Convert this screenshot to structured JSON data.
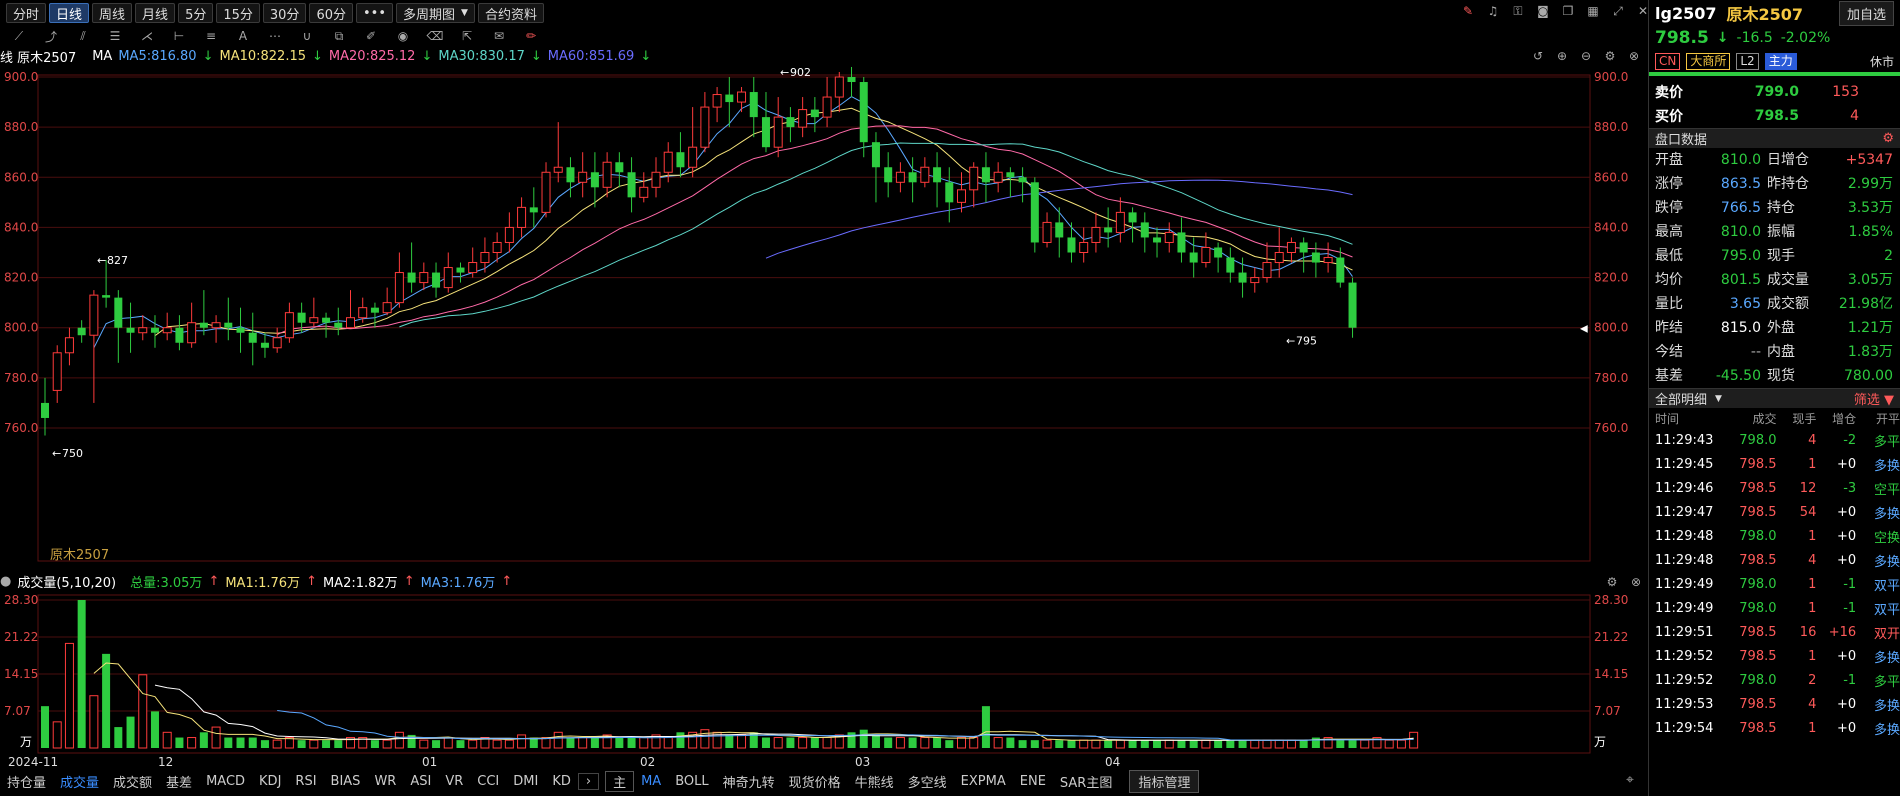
{
  "toolbar": {
    "periods": [
      "分时",
      "日线",
      "周线",
      "月线",
      "5分",
      "15分",
      "30分",
      "60分"
    ],
    "active_period": "日线",
    "more": "•••",
    "multi_period": "多周期图",
    "contract_info": "合约资料"
  },
  "ma_legend": {
    "prefix": "线 原木2507",
    "ma_label": "MA",
    "ma5": "MA5:816.80",
    "ma10": "MA10:822.15",
    "ma20": "MA20:825.12",
    "ma30": "MA30:830.17",
    "ma60": "MA60:851.69"
  },
  "vol_legend": {
    "title": "成交量(5,10,20)",
    "total": "总量:3.05万",
    "ma1": "MA1:1.76万",
    "ma2": "MA2:1.82万",
    "ma3": "MA3:1.76万"
  },
  "chart_data": [
    {
      "type": "candlestick",
      "title": "原木2507",
      "y_ticks": [
        "900.0",
        "880.0",
        "860.0",
        "840.0",
        "820.0",
        "800.0",
        "780.0",
        "760.0"
      ],
      "ylim": [
        750,
        905
      ],
      "x_ticks": [
        "2024-11",
        "12",
        "01",
        "02",
        "03",
        "04"
      ],
      "annotations": {
        "high": "902",
        "low": "795",
        "mid_high": "827",
        "start_low": "750"
      },
      "watermark": "原木2507",
      "candles": [
        [
          770,
          764,
          780,
          757
        ],
        [
          775,
          790,
          793,
          770
        ],
        [
          790,
          796,
          800,
          785
        ],
        [
          800,
          797,
          803,
          794
        ],
        [
          797,
          813,
          815,
          770
        ],
        [
          813,
          812,
          827,
          808
        ],
        [
          812,
          800,
          815,
          786
        ],
        [
          800,
          798,
          810,
          790
        ],
        [
          798,
          800,
          805,
          795
        ],
        [
          800,
          798,
          805,
          792
        ],
        [
          798,
          800,
          806,
          795
        ],
        [
          800,
          794,
          805,
          791
        ],
        [
          794,
          802,
          810,
          792
        ],
        [
          802,
          800,
          815,
          797
        ],
        [
          800,
          802,
          805,
          794
        ],
        [
          802,
          800,
          812,
          795
        ],
        [
          800,
          798,
          808,
          790
        ],
        [
          798,
          794,
          806,
          785
        ],
        [
          794,
          792,
          798,
          788
        ],
        [
          792,
          796,
          800,
          790
        ],
        [
          796,
          806,
          810,
          794
        ],
        [
          806,
          802,
          810,
          798
        ],
        [
          802,
          804,
          812,
          800
        ],
        [
          804,
          802,
          806,
          796
        ],
        [
          802,
          800,
          808,
          797
        ],
        [
          800,
          804,
          815,
          800
        ],
        [
          804,
          808,
          812,
          802
        ],
        [
          808,
          806,
          810,
          800
        ],
        [
          806,
          810,
          816,
          805
        ],
        [
          810,
          822,
          830,
          808
        ],
        [
          822,
          818,
          834,
          814
        ],
        [
          818,
          822,
          826,
          815
        ],
        [
          822,
          816,
          826,
          812
        ],
        [
          816,
          824,
          830,
          814
        ],
        [
          824,
          822,
          826,
          818
        ],
        [
          822,
          826,
          832,
          820
        ],
        [
          826,
          830,
          836,
          822
        ],
        [
          830,
          834,
          838,
          826
        ],
        [
          834,
          840,
          846,
          830
        ],
        [
          840,
          848,
          852,
          836
        ],
        [
          848,
          846,
          856,
          840
        ],
        [
          846,
          862,
          866,
          844
        ],
        [
          862,
          864,
          882,
          858
        ],
        [
          864,
          858,
          868,
          852
        ],
        [
          858,
          862,
          870,
          852
        ],
        [
          862,
          856,
          870,
          848
        ],
        [
          856,
          866,
          870,
          852
        ],
        [
          866,
          862,
          870,
          856
        ],
        [
          862,
          852,
          868,
          846
        ],
        [
          852,
          856,
          862,
          850
        ],
        [
          856,
          862,
          868,
          852
        ],
        [
          862,
          870,
          874,
          858
        ],
        [
          870,
          864,
          878,
          860
        ],
        [
          864,
          872,
          888,
          860
        ],
        [
          872,
          888,
          894,
          870
        ],
        [
          888,
          893,
          896,
          882
        ],
        [
          893,
          890,
          900,
          880
        ],
        [
          890,
          894,
          896,
          886
        ],
        [
          894,
          884,
          900,
          876
        ],
        [
          884,
          872,
          894,
          870
        ],
        [
          872,
          884,
          892,
          868
        ],
        [
          884,
          880,
          888,
          874
        ],
        [
          880,
          887,
          892,
          876
        ],
        [
          887,
          884,
          892,
          878
        ],
        [
          884,
          892,
          900,
          880
        ],
        [
          892,
          900,
          902,
          886
        ],
        [
          900,
          898,
          904,
          892
        ],
        [
          898,
          874,
          900,
          868
        ],
        [
          874,
          864,
          878,
          850
        ],
        [
          864,
          858,
          870,
          852
        ],
        [
          858,
          862,
          866,
          854
        ],
        [
          862,
          858,
          868,
          850
        ],
        [
          858,
          864,
          868,
          856
        ],
        [
          864,
          858,
          870,
          848
        ],
        [
          858,
          850,
          864,
          842
        ],
        [
          850,
          855,
          862,
          846
        ],
        [
          855,
          864,
          866,
          848
        ],
        [
          864,
          858,
          870,
          850
        ],
        [
          858,
          862,
          866,
          854
        ],
        [
          862,
          860,
          864,
          852
        ],
        [
          860,
          858,
          864,
          850
        ],
        [
          858,
          834,
          860,
          830
        ],
        [
          834,
          842,
          846,
          832
        ],
        [
          842,
          836,
          848,
          828
        ],
        [
          836,
          830,
          842,
          826
        ],
        [
          830,
          834,
          840,
          826
        ],
        [
          834,
          840,
          846,
          830
        ],
        [
          840,
          838,
          848,
          832
        ],
        [
          838,
          846,
          852,
          834
        ],
        [
          846,
          842,
          848,
          834
        ],
        [
          842,
          836,
          846,
          830
        ],
        [
          836,
          834,
          840,
          828
        ],
        [
          834,
          838,
          842,
          830
        ],
        [
          838,
          830,
          844,
          826
        ],
        [
          830,
          826,
          836,
          820
        ],
        [
          826,
          832,
          838,
          824
        ],
        [
          832,
          828,
          834,
          822
        ],
        [
          828,
          822,
          832,
          818
        ],
        [
          822,
          818,
          828,
          812
        ],
        [
          818,
          820,
          824,
          814
        ],
        [
          820,
          826,
          834,
          818
        ],
        [
          826,
          830,
          840,
          820
        ],
        [
          830,
          834,
          836,
          826
        ],
        [
          834,
          830,
          836,
          822
        ],
        [
          830,
          826,
          834,
          820
        ],
        [
          826,
          828,
          834,
          822
        ],
        [
          828,
          818,
          832,
          816
        ],
        [
          818,
          800,
          820,
          796
        ]
      ]
    },
    {
      "type": "bar",
      "title": "成交量(5,10,20)",
      "y_ticks": [
        "28.30",
        "21.22",
        "14.15",
        "7.07"
      ],
      "unit": "万",
      "ylim": [
        0,
        28.3
      ],
      "values": [
        8,
        5,
        20,
        28.3,
        10,
        18,
        4,
        6,
        14,
        7,
        3,
        2,
        2,
        3,
        4,
        2,
        2,
        2,
        1.5,
        1.5,
        2,
        1.5,
        1.5,
        1.5,
        1.5,
        2,
        2,
        1.5,
        1.5,
        3,
        2.5,
        1.5,
        1.5,
        2,
        1.5,
        1.5,
        2,
        1.5,
        1.5,
        2.5,
        2,
        2,
        3,
        2,
        2,
        2,
        2.5,
        2,
        2,
        2,
        2.5,
        2,
        3,
        3,
        3.5,
        3,
        2.5,
        2.5,
        3,
        2,
        2,
        2,
        2,
        2,
        2,
        2.5,
        3,
        3.5,
        2.5,
        2,
        2,
        2,
        2,
        2,
        1.5,
        2,
        2,
        8,
        2,
        2,
        1.5,
        1.5,
        1.5,
        1.5,
        1.5,
        1.5,
        1.5,
        1.5,
        1.5,
        1.5,
        1.5,
        1.5,
        1.5,
        1.5,
        1.5,
        1.5,
        1.5,
        1.5,
        1.5,
        1.5,
        1.5,
        1.5,
        1.5,
        1.5,
        2,
        2,
        1.5,
        1.5,
        1.5,
        2,
        1.5,
        1.5,
        3
      ]
    }
  ],
  "bottom_tabs": [
    "持仓量",
    "成交量",
    "成交额",
    "基差",
    "MACD",
    "KDJ",
    "RSI",
    "BIAS",
    "WR",
    "ASI",
    "VR",
    "CCI",
    "DMI",
    "KD"
  ],
  "active_bottom": "成交量",
  "overlay_tabs": [
    "主",
    "MA",
    "BOLL",
    "神奇九转",
    "现货价格",
    "牛熊线",
    "多空线",
    "EXPMA",
    "ENE",
    "SAR主图"
  ],
  "active_overlay": "MA",
  "indicator_manage": "指标管理",
  "panel": {
    "code": "lg2507",
    "name": "原木2507",
    "add_watch": "加自选",
    "price": "798.5",
    "arrow": "↓",
    "change": "-16.5",
    "change_pct": "-2.02%",
    "tags": [
      "CN",
      "大商所",
      "L2",
      "主力"
    ],
    "status": "休市",
    "ask_label": "卖价",
    "ask_price": "799.0",
    "ask_vol": "153",
    "bid_label": "买价",
    "bid_price": "798.5",
    "bid_vol": "4",
    "section_quote": "盘口数据",
    "stats": [
      [
        "开盘",
        "810.0",
        "日增仓",
        "+5347"
      ],
      [
        "涨停",
        "863.5",
        "昨持仓",
        "2.99万"
      ],
      [
        "跌停",
        "766.5",
        "持仓",
        "3.53万"
      ],
      [
        "最高",
        "810.0",
        "振幅",
        "1.85%"
      ],
      [
        "最低",
        "795.0",
        "现手",
        "2"
      ],
      [
        "均价",
        "801.5",
        "成交量",
        "3.05万"
      ],
      [
        "量比",
        "3.65",
        "成交额",
        "21.98亿"
      ],
      [
        "昨结",
        "815.0",
        "外盘",
        "1.21万"
      ],
      [
        "今结",
        "--",
        "内盘",
        "1.83万"
      ],
      [
        "基差",
        "-45.50",
        "现货",
        "780.00"
      ]
    ],
    "section_trades": "全部明细",
    "filter": "筛选",
    "trade_headers": [
      "时间",
      "成交",
      "现手",
      "增仓",
      "开平"
    ],
    "trades": [
      [
        "11:29:43",
        "798.0",
        "4",
        "-2",
        "多平"
      ],
      [
        "11:29:45",
        "798.5",
        "1",
        "+0",
        "多换"
      ],
      [
        "11:29:46",
        "798.5",
        "12",
        "-3",
        "空平"
      ],
      [
        "11:29:47",
        "798.5",
        "54",
        "+0",
        "多换"
      ],
      [
        "11:29:48",
        "798.0",
        "1",
        "+0",
        "空换"
      ],
      [
        "11:29:48",
        "798.5",
        "4",
        "+0",
        "多换"
      ],
      [
        "11:29:49",
        "798.0",
        "1",
        "-1",
        "双平"
      ],
      [
        "11:29:49",
        "798.0",
        "1",
        "-1",
        "双平"
      ],
      [
        "11:29:51",
        "798.5",
        "16",
        "+16",
        "双开"
      ],
      [
        "11:29:52",
        "798.5",
        "1",
        "+0",
        "多换"
      ],
      [
        "11:29:52",
        "798.0",
        "2",
        "-1",
        "多平"
      ],
      [
        "11:29:53",
        "798.5",
        "4",
        "+0",
        "多换"
      ],
      [
        "11:29:54",
        "798.5",
        "1",
        "+0",
        "多换"
      ]
    ]
  }
}
